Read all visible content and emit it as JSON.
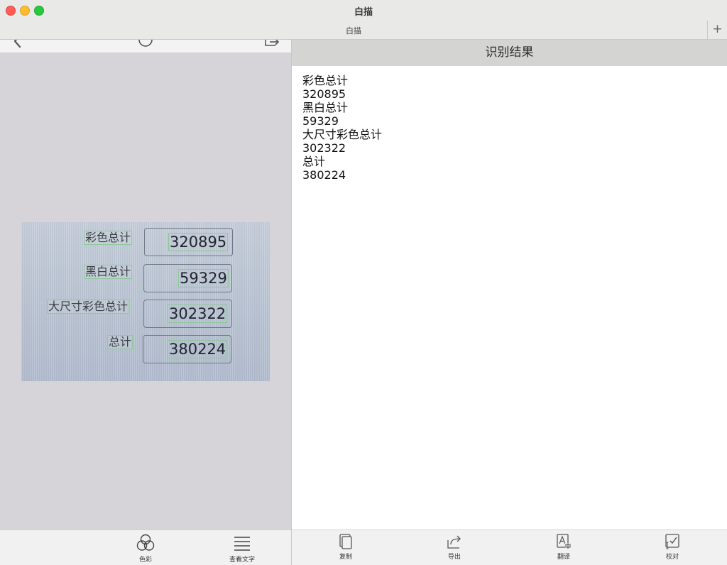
{
  "window": {
    "title": "白描"
  },
  "tabs": [
    {
      "label": "白描"
    }
  ],
  "tab_add_label": "+",
  "image": {
    "labels": [
      "彩色总计",
      "黑白总计",
      "大尺寸彩色总计",
      "总计"
    ],
    "values": [
      "320895",
      "59329",
      "302322",
      "380224"
    ]
  },
  "result": {
    "header": "识别结果",
    "lines": [
      "彩色总计",
      "320895",
      "黑白总计",
      "59329",
      "大尺寸彩色总计",
      "302322",
      "总计",
      "380224"
    ]
  },
  "left_toolbar": [
    {
      "label": "色彩",
      "icon": "color-circles-icon"
    },
    {
      "label": "查看文字",
      "icon": "text-lines-icon"
    }
  ],
  "right_toolbar": [
    {
      "label": "复制",
      "icon": "copy-icon"
    },
    {
      "label": "导出",
      "icon": "export-icon"
    },
    {
      "label": "翻译",
      "icon": "translate-icon"
    },
    {
      "label": "校对",
      "icon": "proofread-icon"
    }
  ],
  "colors": {
    "close": "#fe5f57",
    "minimize": "#febc2e",
    "maximize": "#28c840",
    "ocr_box": "#8fc79a",
    "pane_bg": "#d6d3d9",
    "header_bg": "#d4d4d2"
  }
}
